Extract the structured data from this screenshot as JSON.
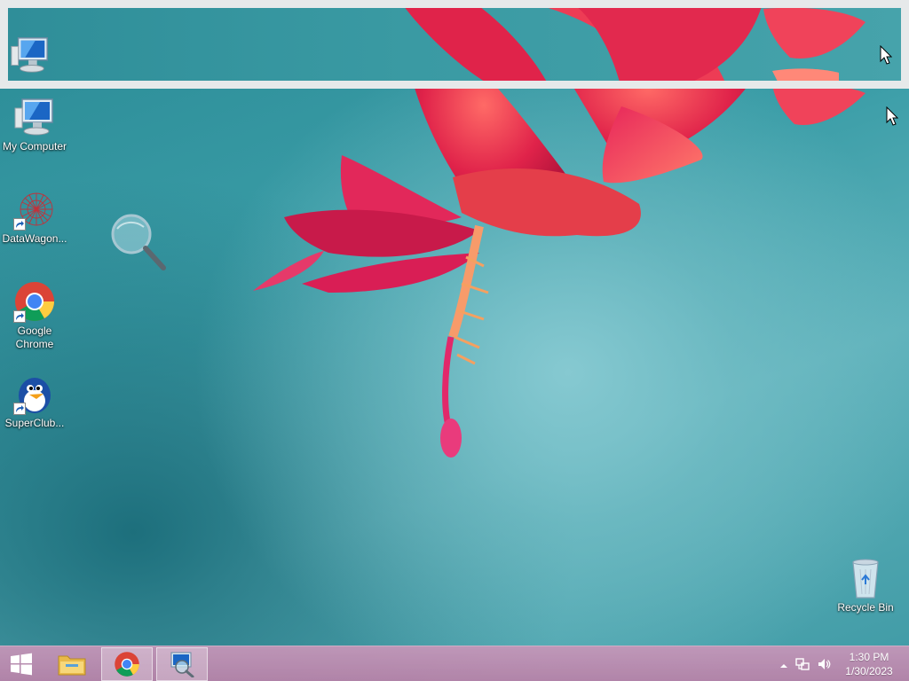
{
  "desktop": {
    "icons": [
      {
        "name": "my-computer",
        "label": "My Computer"
      },
      {
        "name": "datawagon",
        "label": "DataWagon..."
      },
      {
        "name": "google-chrome",
        "label": "Google Chrome"
      },
      {
        "name": "superclub",
        "label": "SuperClub..."
      },
      {
        "name": "recycle-bin",
        "label": "Recycle Bin"
      }
    ]
  },
  "taskbar": {
    "start_icon": "windows-logo-icon",
    "pinned": [
      {
        "name": "file-explorer",
        "icon": "folder-icon",
        "active": false
      },
      {
        "name": "google-chrome",
        "icon": "chrome-icon",
        "active": true
      },
      {
        "name": "magnifier",
        "icon": "magnifier-icon",
        "active": true
      }
    ],
    "tray": {
      "icons": [
        "show-hidden-icons-chevron",
        "network-icon",
        "volume-icon"
      ],
      "time": "1:30 PM",
      "date": "1/30/2023"
    }
  },
  "colors": {
    "wallpaper_teal": "#3c9ea8",
    "flower_red": "#e0234a",
    "taskbar_pink": "#c196b9",
    "magnifier_border": "#e6e9ea"
  }
}
